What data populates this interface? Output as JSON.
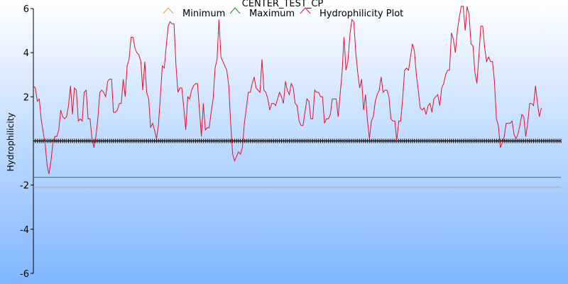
{
  "chart_data": {
    "type": "line",
    "title": "CENTER_TEST_CP",
    "xlabel": "",
    "ylabel": "Hydrophilicity",
    "ylim": [
      -6,
      6
    ],
    "yticks": [
      6,
      4,
      2,
      -2,
      -4,
      -6
    ],
    "xlim": [
      0,
      270
    ],
    "legend_position": "top",
    "background": {
      "top": "#ffffff",
      "bottom": "#7fb6ff"
    },
    "series": [
      {
        "name": "Minimum",
        "color": "#e6a23c",
        "constant": -2.1
      },
      {
        "name": "Maximum",
        "color": "#208a20",
        "constant": -1.65
      },
      {
        "name": "Hydrophilicity Plot",
        "color": "#e8102a",
        "values": [
          2.5,
          2.4,
          1.8,
          1.9,
          1.0,
          0.4,
          -0.1,
          -1.1,
          -1.5,
          -0.9,
          -0.1,
          0.2,
          0.2,
          0.5,
          1.4,
          1.1,
          1.0,
          1.1,
          1.6,
          2.5,
          1.2,
          2.4,
          2.3,
          0.9,
          1.0,
          0.9,
          2.2,
          2.3,
          1.0,
          1.0,
          0.1,
          -0.3,
          0.2,
          1.0,
          2.2,
          2.3,
          2.2,
          2.0,
          2.7,
          2.8,
          2.8,
          1.3,
          1.3,
          1.4,
          1.7,
          1.7,
          2.8,
          2.0,
          3.4,
          3.7,
          4.7,
          4.7,
          4.2,
          4.0,
          3.9,
          3.6,
          2.3,
          3.6,
          2.2,
          1.9,
          0.6,
          0.8,
          0.5,
          0.1,
          0.7,
          2.0,
          3.4,
          3.3,
          4.3,
          5.2,
          5.4,
          5.3,
          5.3,
          3.4,
          2.2,
          2.4,
          2.4,
          1.5,
          0.5,
          2.0,
          1.9,
          2.3,
          2.5,
          2.6,
          2.6,
          1.4,
          0.2,
          1.7,
          0.5,
          0.6,
          0.6,
          1.3,
          1.9,
          3.3,
          3.7,
          5.5,
          3.8,
          3.6,
          3.4,
          3.2,
          2.5,
          0.8,
          -0.6,
          -0.9,
          -0.7,
          -0.5,
          -0.6,
          -0.3,
          0.8,
          1.5,
          2.2,
          2.2,
          2.6,
          2.9,
          2.4,
          2.3,
          2.2,
          3.7,
          2.3,
          2.2,
          1.9,
          1.4,
          1.7,
          1.7,
          1.6,
          1.9,
          2.2,
          2.0,
          1.7,
          2.7,
          2.3,
          2.1,
          2.6,
          2.4,
          1.7,
          1.6,
          0.9,
          0.7,
          0.7,
          1.3,
          1.9,
          1.8,
          1.0,
          1.0,
          2.3,
          2.2,
          2.2,
          2.0,
          2.0,
          0.8,
          1.0,
          1.0,
          1.2,
          1.9,
          1.9,
          1.9,
          1.1,
          2.1,
          3.1,
          4.7,
          3.2,
          3.6,
          4.8,
          5.5,
          5.4,
          4.0,
          3.1,
          2.4,
          2.8,
          1.4,
          2.1,
          0.9,
          0.1,
          0.9,
          1.1,
          1.8,
          2.1,
          2.3,
          2.9,
          2.2,
          2.3,
          2.3,
          2.0,
          1.0,
          0.9,
          0.9,
          0.0,
          0.9,
          0.9,
          1.9,
          3.2,
          3.3,
          3.2,
          3.8,
          4.4,
          4.1,
          3.0,
          2.3,
          1.5,
          1.4,
          1.5,
          1.2,
          1.6,
          1.7,
          1.3,
          1.9,
          2.0,
          2.1,
          1.6,
          2.4,
          2.6,
          3.0,
          3.2,
          3.2,
          4.9,
          4.6,
          4.0,
          5.0,
          5.6,
          6.1,
          6.1,
          5.0,
          6.1,
          5.7,
          4.4,
          4.3,
          3.1,
          2.6,
          3.8,
          5.2,
          5.2,
          4.2,
          3.6,
          3.8,
          3.6,
          3.6,
          2.7,
          1.0,
          0.7,
          -0.3,
          -0.1,
          0.2,
          0.8,
          0.8,
          0.8,
          0.9,
          0.3,
          0.1,
          0.3,
          0.7,
          1.2,
          1.1,
          0.2,
          0.8,
          1.7,
          1.7,
          1.6,
          2.5,
          1.7,
          1.1,
          1.5
        ]
      }
    ]
  }
}
